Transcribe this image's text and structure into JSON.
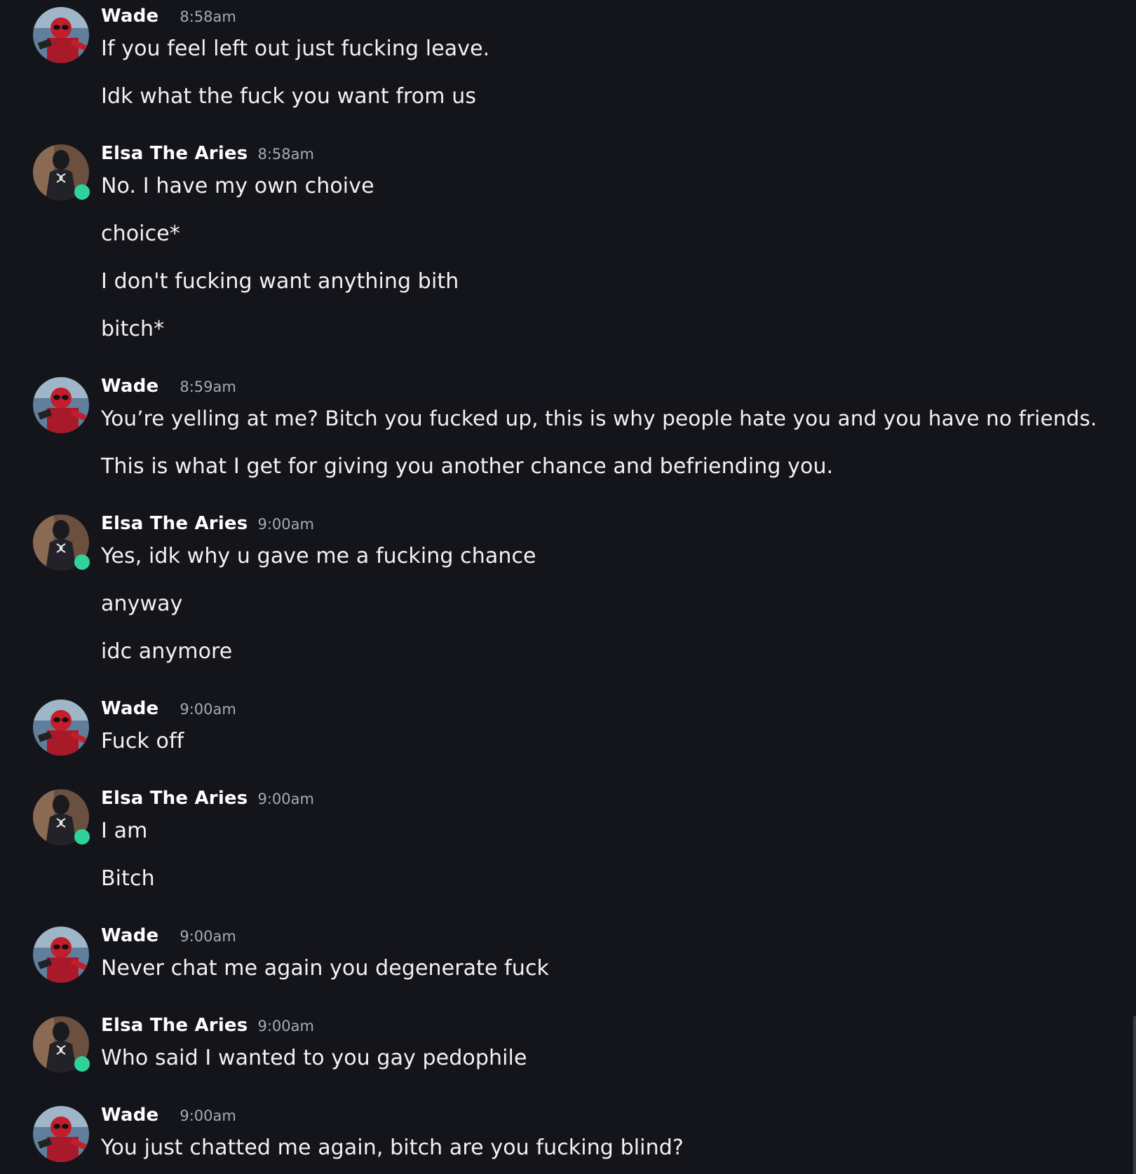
{
  "users": {
    "wade": {
      "name": "Wade",
      "avatar_icon": "deadpool-avatar-icon",
      "online": false
    },
    "elsa": {
      "name": "Elsa The Aries",
      "avatar_icon": "dark-spider-suit-avatar-icon",
      "online": true
    }
  },
  "colors": {
    "background": "#14141b",
    "online_status": "#2fd39a",
    "timestamp": "#a9a9b3",
    "text": "#f2f2f4"
  },
  "messages": [
    {
      "author": "Wade",
      "time": "8:58am",
      "lines": [
        "If you feel left out just fucking leave.",
        "Idk what the fuck you want from us"
      ]
    },
    {
      "author": "Elsa The Aries",
      "time": "8:58am",
      "lines": [
        "No. I have my own choive",
        "choice*",
        "I don't fucking want anything bith",
        "bitch*"
      ]
    },
    {
      "author": "Wade",
      "time": "8:59am",
      "lines": [
        "You’re yelling at me? Bitch you fucked up, this is why people hate you and you have no friends.",
        "This is what I get for giving you another chance and befriending you."
      ]
    },
    {
      "author": "Elsa The Aries",
      "time": "9:00am",
      "lines": [
        "Yes, idk why u gave me a fucking chance",
        "anyway",
        "idc anymore"
      ]
    },
    {
      "author": "Wade",
      "time": "9:00am",
      "lines": [
        "Fuck off"
      ]
    },
    {
      "author": "Elsa The Aries",
      "time": "9:00am",
      "lines": [
        "I am",
        "Bitch"
      ]
    },
    {
      "author": "Wade",
      "time": "9:00am",
      "lines": [
        "Never chat me again you degenerate fuck"
      ]
    },
    {
      "author": "Elsa The Aries",
      "time": "9:00am",
      "lines": [
        "Who said I wanted to you gay pedophile"
      ]
    },
    {
      "author": "Wade",
      "time": "9:00am",
      "lines": [
        "You just chatted me again, bitch are you fucking blind?"
      ]
    }
  ]
}
